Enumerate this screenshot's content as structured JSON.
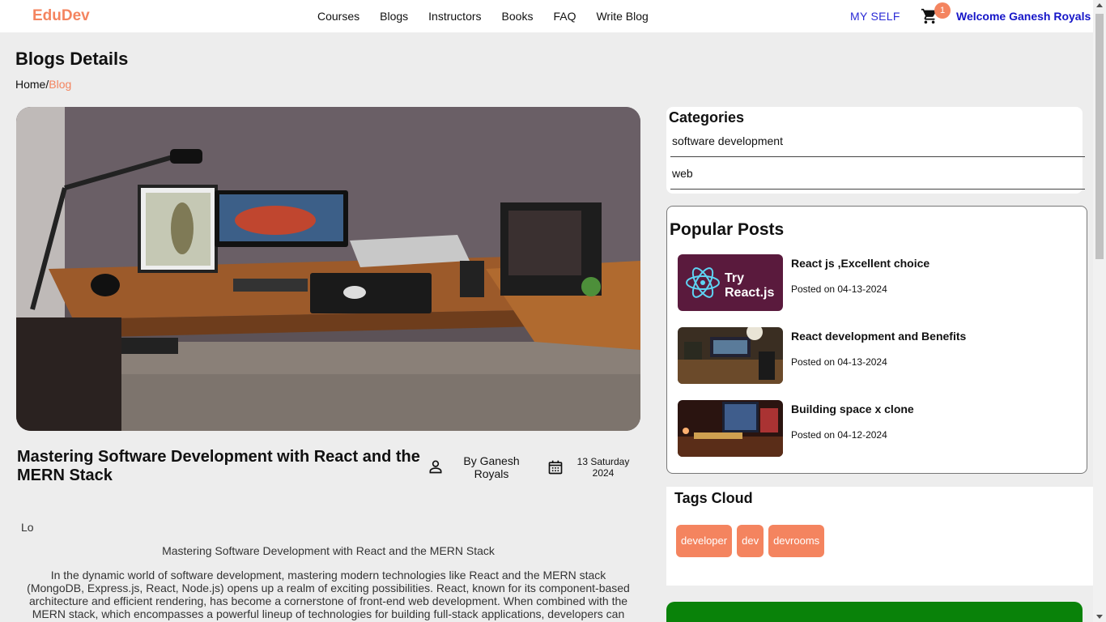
{
  "header": {
    "logo": "EduDev",
    "nav": [
      "Courses",
      "Blogs",
      "Instructors",
      "Books",
      "FAQ",
      "Write Blog"
    ],
    "my_self": "MY SELF",
    "cart_count": "1",
    "welcome": "Welcome Ganesh Royals"
  },
  "page": {
    "title": "Blogs Details",
    "breadcrumb_home": "Home",
    "breadcrumb_sep": "/",
    "breadcrumb_current": "Blog"
  },
  "article": {
    "title": "Mastering Software Development with React and the MERN Stack",
    "author": "By Ganesh Royals",
    "date": "13 Saturday 2024",
    "intro": "Lo",
    "body_heading": "Mastering Software Development with React and the MERN Stack",
    "body_text": "In the dynamic world of software development, mastering modern technologies like React and the MERN stack (MongoDB, Express.js, React, Node.js) opens up a realm of exciting possibilities. React, known for its component-based architecture and efficient rendering, has become a cornerstone of front-end web development. When combined with the MERN stack, which encompasses a powerful lineup of technologies for building full-stack applications, developers can"
  },
  "sidebar": {
    "categories_title": "Categories",
    "categories": [
      "software development",
      "web"
    ],
    "popular_title": "Popular Posts",
    "posts": [
      {
        "title": "React js ,Excellent choice",
        "date": "Posted on 04-13-2024",
        "thumb_text_1": "Try",
        "thumb_text_2": "React.js"
      },
      {
        "title": "React development and Benefits",
        "date": "Posted on 04-13-2024"
      },
      {
        "title": "Building space x clone",
        "date": "Posted on 04-12-2024"
      }
    ],
    "tags_title": "Tags Cloud",
    "tags": [
      "developer",
      "dev",
      "devrooms"
    ]
  },
  "colors": {
    "accent": "#f4845f",
    "link_blue": "#1515c8",
    "green_card": "#098209"
  }
}
